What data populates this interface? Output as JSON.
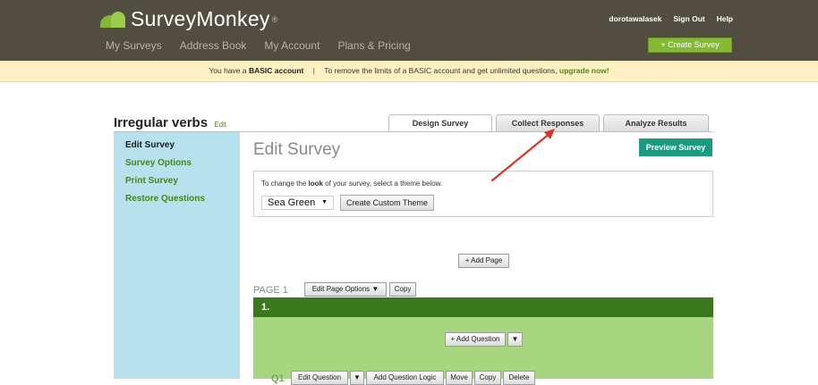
{
  "brand": {
    "name": "SurveyMonkey",
    "tm": "®",
    "logo_colors": [
      "#84b636",
      "#9ccc4b"
    ]
  },
  "main_nav": [
    "My Surveys",
    "Address Book",
    "My Account",
    "Plans & Pricing"
  ],
  "user_nav": {
    "username": "dorotawalasek",
    "sign_out": "Sign Out",
    "help": "Help",
    "separator": "·"
  },
  "create_survey_label": "+ Create Survey",
  "banner": {
    "prefix": "You have a",
    "account": "BASIC account",
    "separator": "|",
    "message": "To remove the limits of a BASIC account and get unlimited questions,",
    "link": "upgrade now!"
  },
  "survey": {
    "title": "Irregular verbs",
    "edit_link": "Edit"
  },
  "tabs": [
    {
      "label": "Design Survey",
      "active": true
    },
    {
      "label": "Collect Responses",
      "active": false
    },
    {
      "label": "Analyze Results",
      "active": false
    }
  ],
  "sidebar": {
    "items": [
      "Edit Survey",
      "Survey Options",
      "Print Survey",
      "Restore Questions"
    ]
  },
  "main": {
    "heading": "Edit Survey",
    "preview_label": "Preview Survey",
    "theme_prompt_prefix": "To change the",
    "theme_prompt_bold": "look",
    "theme_prompt_suffix": "of your survey, select a theme below.",
    "theme_value": "Sea Green",
    "create_theme_label": "Create Custom Theme",
    "add_page_label": "+ Add Page",
    "page_label": "PAGE 1",
    "edit_page_options_label": "Edit Page Options ▼",
    "copy_label": "Copy",
    "question_number": "1.",
    "add_question_label": "+ Add Question",
    "dropdown_arrow": "▼",
    "q_label": "Q1",
    "question_buttons": [
      "Edit Question",
      "▼",
      "Add Question Logic",
      "Move",
      "Copy",
      "Delete"
    ]
  },
  "colors": {
    "topbar": "#514e41",
    "accent_green": "#86b836",
    "sidebar": "#b6e1ed",
    "page_header": "#3a7a1c",
    "page_body": "#a8d680",
    "preview": "#1a9a7e",
    "annotation_arrow": "#d9342b"
  }
}
